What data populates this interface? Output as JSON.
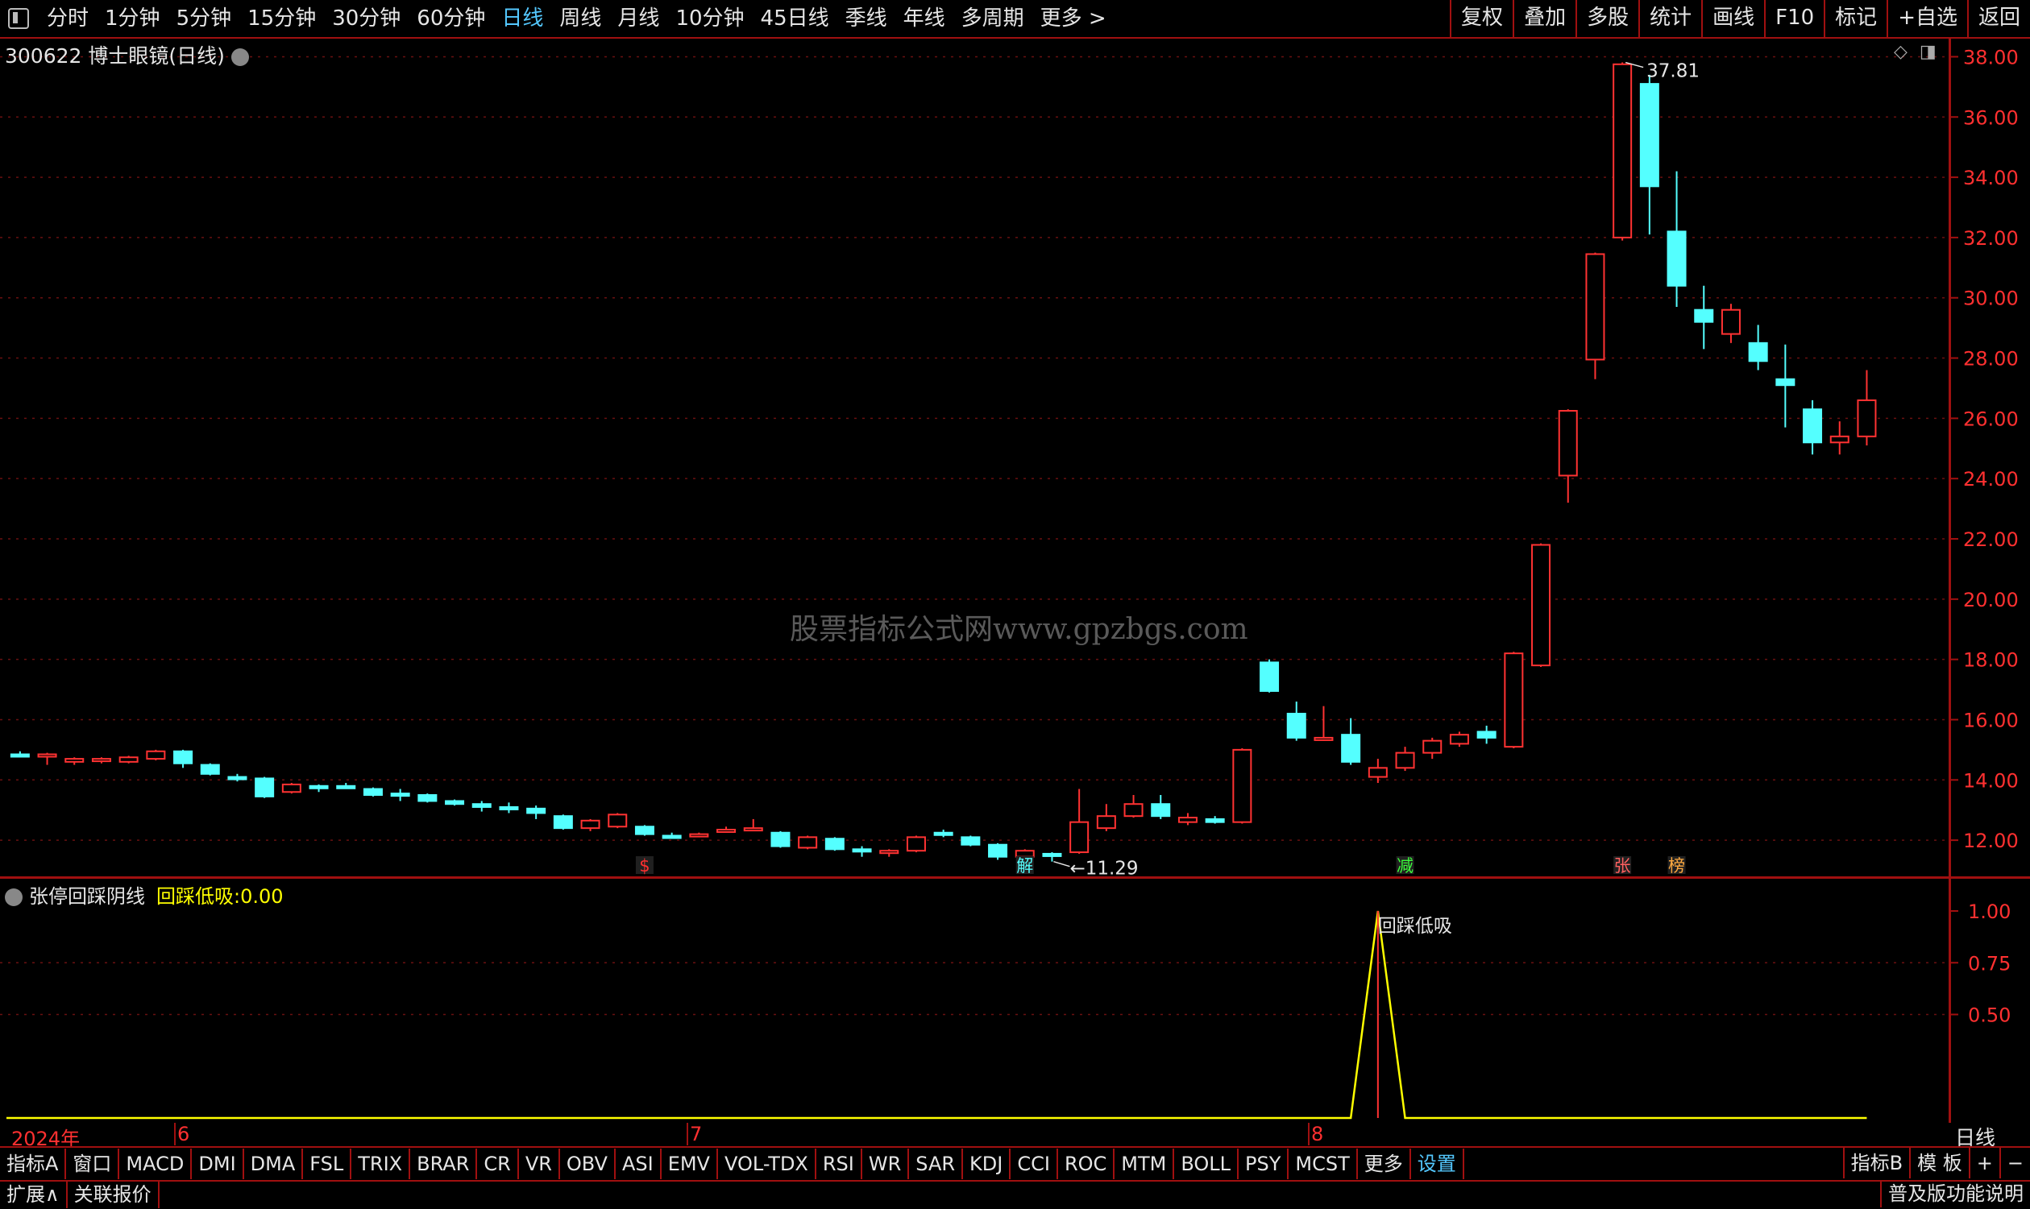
{
  "toolbar": {
    "periods": [
      "分时",
      "1分钟",
      "5分钟",
      "15分钟",
      "30分钟",
      "60分钟",
      "日线",
      "周线",
      "月线",
      "10分钟",
      "45日线",
      "季线",
      "年线",
      "多周期",
      "更多 >"
    ],
    "active_index": 6,
    "tools": [
      "复权",
      "叠加",
      "多股",
      "统计",
      "画线",
      "F10",
      "标记",
      "+自选",
      "返回"
    ]
  },
  "stock": {
    "title": "300622 博士眼镜(日线)"
  },
  "indicator": {
    "name": "张停回踩阴线",
    "label": "回踩低吸:",
    "value": "0.00",
    "signal_text": "回踩低吸"
  },
  "watermark": "股票指标公式网www.gpzbgs.com",
  "period_label": "日线",
  "x_labels": [
    "2024年",
    "6",
    "7",
    "8"
  ],
  "bottom_tabs": [
    "指标A",
    "窗口",
    "MACD",
    "DMI",
    "DMA",
    "FSL",
    "TRIX",
    "BRAR",
    "CR",
    "VR",
    "OBV",
    "ASI",
    "EMV",
    "VOL-TDX",
    "RSI",
    "WR",
    "SAR",
    "KDJ",
    "CCI",
    "ROC",
    "MTM",
    "BOLL",
    "PSY",
    "MCST",
    "更多",
    "设置"
  ],
  "bottom_active": 25,
  "bottom_right": [
    "指标B",
    "模 板",
    "+",
    "−"
  ],
  "status": {
    "left": [
      "扩展∧",
      "关联报价"
    ],
    "right": "普及版功能说明"
  },
  "colors": {
    "up": "#ff3232",
    "down": "#54ffff",
    "axis": "#a01010",
    "indicator_line": "#ffff00"
  },
  "chart_data": [
    {
      "type": "candlestick",
      "y_ticks": [
        "38.00",
        "36.00",
        "34.00",
        "32.00",
        "30.00",
        "28.00",
        "26.00",
        "24.00",
        "22.00",
        "20.00",
        "18.00",
        "16.00",
        "14.00",
        "12.00"
      ],
      "ylim": [
        10.8,
        38.6
      ],
      "high_label": "37.81",
      "low_label": "11.29",
      "markers": [
        {
          "index": 23,
          "text": "$",
          "color": "#ff3030"
        },
        {
          "index": 37,
          "text": "解",
          "color": "#54ffff"
        },
        {
          "index": 51,
          "text": "减",
          "color": "#3cff3c"
        },
        {
          "index": 59,
          "text": "张",
          "color": "#ff6060"
        },
        {
          "index": 61,
          "text": "榜",
          "color": "#ffaa40"
        }
      ],
      "candles": [
        [
          14.85,
          14.95,
          14.75,
          14.8
        ],
        [
          14.8,
          14.9,
          14.5,
          14.85
        ],
        [
          14.6,
          14.75,
          14.5,
          14.7
        ],
        [
          14.62,
          14.75,
          14.55,
          14.7
        ],
        [
          14.6,
          14.8,
          14.55,
          14.75
        ],
        [
          14.7,
          15.0,
          14.65,
          14.95
        ],
        [
          14.95,
          15.0,
          14.4,
          14.55
        ],
        [
          14.5,
          14.55,
          14.15,
          14.2
        ],
        [
          14.1,
          14.2,
          13.95,
          14.05
        ],
        [
          14.05,
          14.1,
          13.4,
          13.45
        ],
        [
          13.6,
          13.9,
          13.55,
          13.85
        ],
        [
          13.8,
          13.85,
          13.6,
          13.75
        ],
        [
          13.8,
          13.9,
          13.7,
          13.75
        ],
        [
          13.7,
          13.75,
          13.45,
          13.5
        ],
        [
          13.55,
          13.7,
          13.3,
          13.5
        ],
        [
          13.5,
          13.55,
          13.25,
          13.3
        ],
        [
          13.3,
          13.35,
          13.15,
          13.2
        ],
        [
          13.2,
          13.3,
          12.95,
          13.1
        ],
        [
          13.1,
          13.25,
          12.9,
          13.05
        ],
        [
          13.05,
          13.15,
          12.7,
          12.9
        ],
        [
          12.8,
          12.85,
          12.35,
          12.4
        ],
        [
          12.4,
          12.7,
          12.3,
          12.65
        ],
        [
          12.45,
          12.9,
          12.4,
          12.85
        ],
        [
          12.45,
          12.5,
          12.15,
          12.2
        ],
        [
          12.15,
          12.25,
          12.05,
          12.1
        ],
        [
          12.15,
          12.25,
          12.1,
          12.2
        ],
        [
          12.3,
          12.45,
          12.25,
          12.35
        ],
        [
          12.35,
          12.7,
          12.3,
          12.4
        ],
        [
          12.25,
          12.3,
          11.75,
          11.8
        ],
        [
          11.75,
          12.15,
          11.7,
          12.1
        ],
        [
          12.05,
          12.1,
          11.65,
          11.7
        ],
        [
          11.7,
          11.8,
          11.45,
          11.65
        ],
        [
          11.6,
          11.7,
          11.45,
          11.65
        ],
        [
          11.65,
          12.15,
          11.6,
          12.1
        ],
        [
          12.25,
          12.35,
          12.1,
          12.2
        ],
        [
          12.1,
          12.15,
          11.8,
          11.85
        ],
        [
          11.85,
          11.9,
          11.35,
          11.45
        ],
        [
          11.45,
          11.7,
          11.4,
          11.65
        ],
        [
          11.55,
          11.6,
          11.29,
          11.5
        ],
        [
          11.6,
          13.7,
          11.55,
          12.6
        ],
        [
          12.4,
          13.2,
          12.3,
          12.8
        ],
        [
          12.8,
          13.5,
          12.75,
          13.2
        ],
        [
          13.2,
          13.5,
          12.7,
          12.8
        ],
        [
          12.6,
          12.9,
          12.5,
          12.75
        ],
        [
          12.7,
          12.8,
          12.55,
          12.6
        ],
        [
          12.6,
          15.05,
          12.55,
          15.0
        ],
        [
          17.9,
          18.0,
          16.9,
          16.95
        ],
        [
          16.2,
          16.6,
          15.3,
          15.4
        ],
        [
          15.4,
          16.45,
          15.3,
          15.4
        ],
        [
          15.5,
          16.05,
          14.5,
          14.6
        ],
        [
          14.1,
          14.7,
          13.9,
          14.4
        ],
        [
          14.4,
          15.1,
          14.3,
          14.9
        ],
        [
          14.9,
          15.4,
          14.7,
          15.3
        ],
        [
          15.2,
          15.6,
          15.1,
          15.5
        ],
        [
          15.6,
          15.8,
          15.2,
          15.4
        ],
        [
          15.1,
          18.25,
          15.05,
          18.2
        ],
        [
          17.8,
          21.85,
          17.75,
          21.8
        ],
        [
          24.1,
          26.3,
          23.2,
          26.25
        ],
        [
          27.95,
          31.5,
          27.3,
          31.45
        ],
        [
          32.0,
          37.81,
          31.9,
          37.75
        ],
        [
          37.1,
          37.4,
          32.1,
          33.7
        ],
        [
          32.2,
          34.2,
          29.7,
          30.4
        ],
        [
          29.6,
          30.4,
          28.3,
          29.2
        ],
        [
          28.8,
          29.8,
          28.5,
          29.6
        ],
        [
          28.5,
          29.1,
          27.6,
          27.9
        ],
        [
          27.3,
          28.45,
          25.7,
          27.1
        ],
        [
          26.3,
          26.6,
          24.8,
          25.2
        ],
        [
          25.2,
          25.9,
          24.8,
          25.4
        ],
        [
          25.4,
          27.6,
          25.1,
          26.6
        ]
      ]
    },
    {
      "type": "line",
      "name": "回踩低吸",
      "y_ticks": [
        "1.00",
        "0.75",
        "0.50"
      ],
      "ylim": [
        0,
        1.0
      ],
      "values_by_index": {
        "49": 0,
        "50": 1,
        "51": 0
      },
      "baseline": 0,
      "length": 69
    }
  ]
}
